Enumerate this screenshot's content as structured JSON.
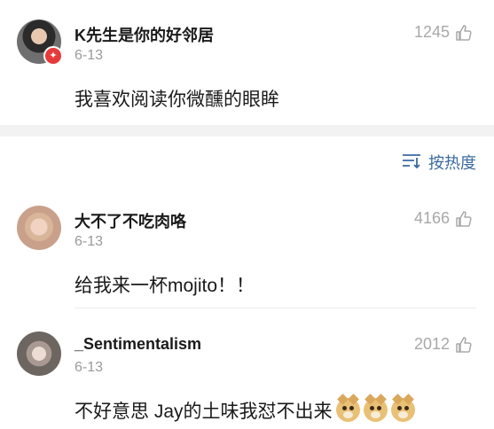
{
  "top_comment": {
    "username": "K先生是你的好邻居",
    "date": "6-13",
    "likes": "1245",
    "text": "我喜欢阅读你微醺的眼眸",
    "verified_badge": "✦"
  },
  "sort": {
    "label": "按热度"
  },
  "comments": [
    {
      "username": "大不了不吃肉咯",
      "date": "6-13",
      "likes": "4166",
      "text": "给我来一杯mojito！！"
    },
    {
      "username": "_Sentimentalism",
      "date": "6-13",
      "likes": "2012",
      "text": "不好意思 Jay的土味我怼不出来",
      "emoji": [
        "doge-icon",
        "doge-icon",
        "doge-icon"
      ]
    }
  ],
  "colors": {
    "accent": "#3b6aa0",
    "verified": "#e63a3a",
    "muted": "#9a9a9a"
  }
}
